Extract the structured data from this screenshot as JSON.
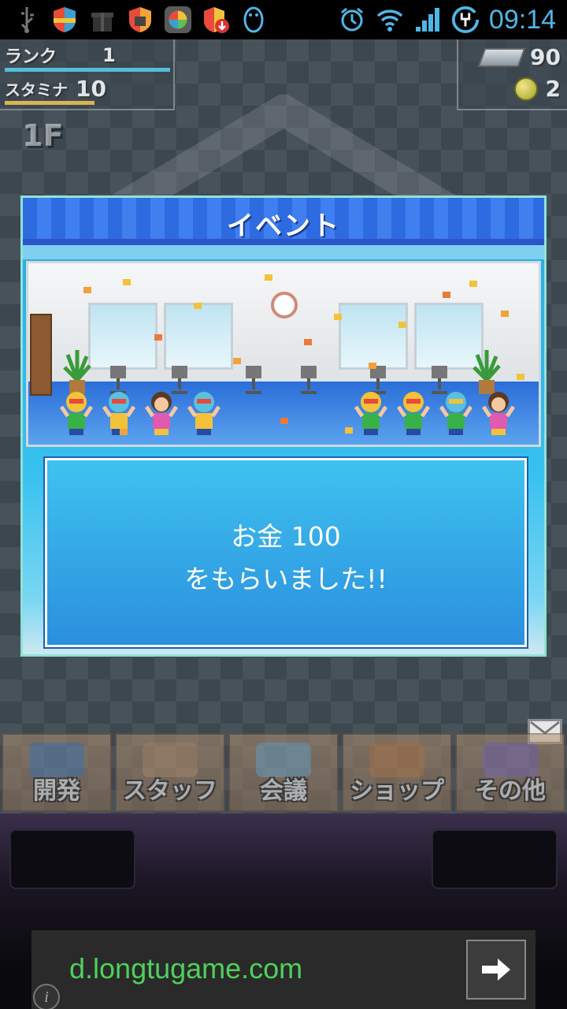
{
  "statusbar": {
    "time": "09:14",
    "icons_left": [
      "usb-icon",
      "shield-icon",
      "gift-icon",
      "shield-icon",
      "app-icon",
      "shield-download-icon",
      "penguin-icon"
    ],
    "icons_right": [
      "alarm-icon",
      "wifi-icon",
      "signal-icon",
      "battery-charging-icon"
    ]
  },
  "hud": {
    "rank_label": "ランク",
    "rank_value": "1",
    "stamina_label": "スタミナ",
    "stamina_value": "10",
    "floor": "1F",
    "tickets": "90",
    "coins": "2"
  },
  "dialog": {
    "title": "イベント",
    "line1": "お金 100",
    "line2": "をもらいました!!"
  },
  "menu": {
    "items": [
      {
        "label": "開発"
      },
      {
        "label": "スタッフ"
      },
      {
        "label": "会議"
      },
      {
        "label": "ショップ"
      },
      {
        "label": "その他"
      }
    ]
  },
  "ad": {
    "url": "d.longtugame.com"
  },
  "colors": {
    "accent_blue": "#36c1ef",
    "status_text": "#4fb6e6",
    "ad_text": "#4fd05c"
  }
}
